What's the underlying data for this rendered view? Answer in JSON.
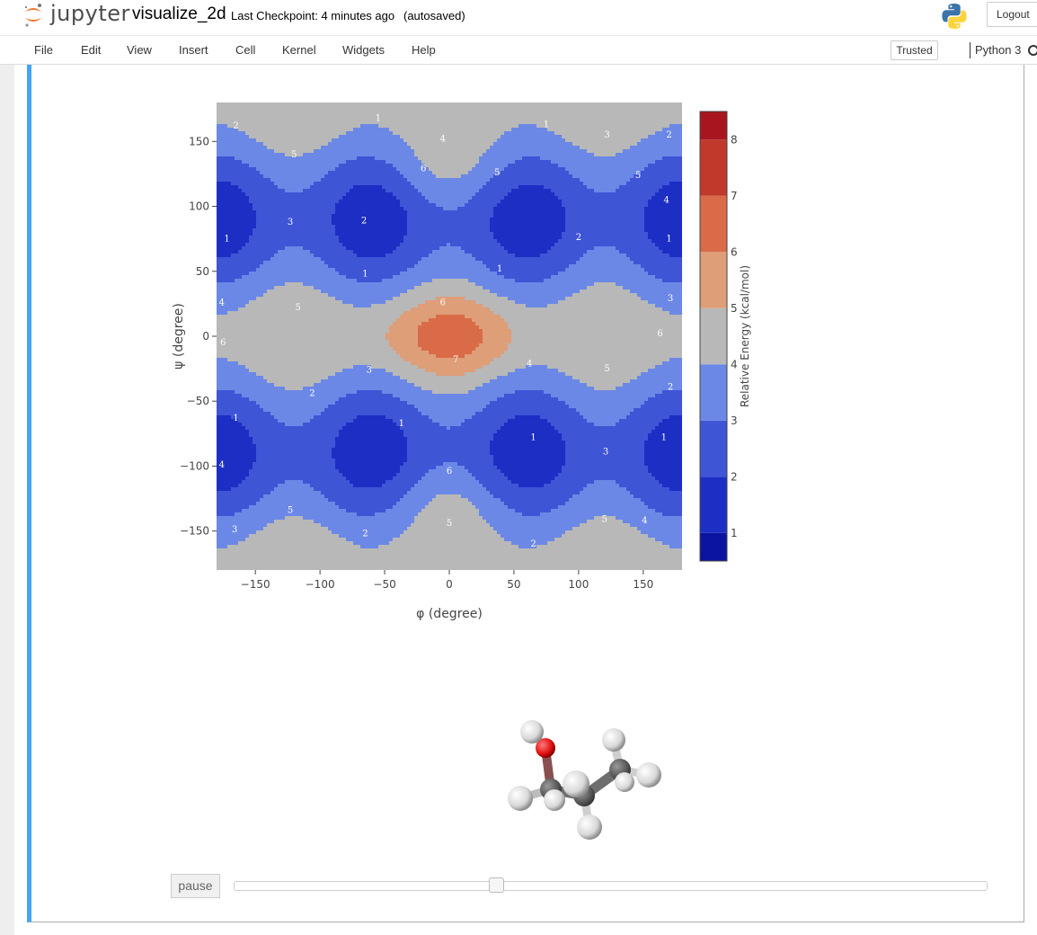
{
  "header": {
    "logo_text": "jupyter",
    "notebook_name": "visualize_2d",
    "checkpoint": "Last Checkpoint: 4 minutes ago",
    "autosave": "(autosaved)",
    "logout_label": "Logout"
  },
  "menubar": {
    "items": [
      "File",
      "Edit",
      "View",
      "Insert",
      "Cell",
      "Kernel",
      "Widgets",
      "Help"
    ],
    "trusted_label": "Trusted",
    "kernel_name": "Python 3"
  },
  "widget": {
    "pause_label": "pause",
    "slider_fraction": 0.345
  },
  "colors": {
    "cell_border_accent": "#42a5f5",
    "colorscale": [
      "#0a14a0",
      "#1c2ec4",
      "#3e55d6",
      "#6b88e6",
      "#b8b8b8",
      "#dd9e78",
      "#d96b48",
      "#c0392b",
      "#a8151f"
    ]
  },
  "chart_data": {
    "type": "contour",
    "xlabel": "φ (degree)",
    "ylabel": "ψ (degree)",
    "xlim": [
      -180,
      180
    ],
    "ylim": [
      -180,
      180
    ],
    "x_ticks": [
      -150,
      -100,
      -50,
      0,
      50,
      100,
      150
    ],
    "y_ticks": [
      150,
      100,
      50,
      0,
      -50,
      -100,
      -150
    ],
    "x_tick_labels": [
      "−150",
      "−100",
      "−50",
      "0",
      "50",
      "100",
      "150"
    ],
    "y_tick_labels": [
      "150",
      "100",
      "50",
      "0",
      "−50",
      "−100",
      "−150"
    ],
    "colorbar": {
      "title": "Relative Energy (kcal/mol)",
      "ticks": [
        1,
        2,
        3,
        4,
        5,
        6,
        7,
        8
      ],
      "range": [
        0.5,
        8.5
      ]
    },
    "contour_labels": [
      {
        "x": -165,
        "y": 162,
        "text": "2"
      },
      {
        "x": -55,
        "y": 168,
        "text": "1"
      },
      {
        "x": 75,
        "y": 163,
        "text": "1"
      },
      {
        "x": 122,
        "y": 155,
        "text": "3"
      },
      {
        "x": 170,
        "y": 155,
        "text": "2"
      },
      {
        "x": -5,
        "y": 152,
        "text": "4"
      },
      {
        "x": -120,
        "y": 140,
        "text": "5"
      },
      {
        "x": -20,
        "y": 129,
        "text": "6"
      },
      {
        "x": 37,
        "y": 126,
        "text": "5"
      },
      {
        "x": 146,
        "y": 124,
        "text": "5"
      },
      {
        "x": 168,
        "y": 105,
        "text": "4"
      },
      {
        "x": -123,
        "y": 88,
        "text": "3"
      },
      {
        "x": -66,
        "y": 89,
        "text": "2"
      },
      {
        "x": -172,
        "y": 75,
        "text": "1"
      },
      {
        "x": 100,
        "y": 76,
        "text": "2"
      },
      {
        "x": 170,
        "y": 75,
        "text": "1"
      },
      {
        "x": -65,
        "y": 48,
        "text": "1"
      },
      {
        "x": 39,
        "y": 52,
        "text": "1"
      },
      {
        "x": 171,
        "y": 29,
        "text": "3"
      },
      {
        "x": -5,
        "y": 26,
        "text": "6"
      },
      {
        "x": -176,
        "y": 26,
        "text": "4"
      },
      {
        "x": -117,
        "y": 22,
        "text": "5"
      },
      {
        "x": -175,
        "y": -5,
        "text": "6"
      },
      {
        "x": 163,
        "y": 2,
        "text": "6"
      },
      {
        "x": 5,
        "y": -18,
        "text": "7"
      },
      {
        "x": 62,
        "y": -21,
        "text": "4"
      },
      {
        "x": 122,
        "y": -25,
        "text": "5"
      },
      {
        "x": -62,
        "y": -26,
        "text": "3"
      },
      {
        "x": -106,
        "y": -44,
        "text": "2"
      },
      {
        "x": 171,
        "y": -39,
        "text": "2"
      },
      {
        "x": -165,
        "y": -63,
        "text": "1"
      },
      {
        "x": -37,
        "y": -67,
        "text": "1"
      },
      {
        "x": 65,
        "y": -78,
        "text": "1"
      },
      {
        "x": 166,
        "y": -78,
        "text": "1"
      },
      {
        "x": 121,
        "y": -89,
        "text": "3"
      },
      {
        "x": -176,
        "y": -99,
        "text": "4"
      },
      {
        "x": 0,
        "y": -104,
        "text": "6"
      },
      {
        "x": -123,
        "y": -134,
        "text": "5"
      },
      {
        "x": 0,
        "y": -144,
        "text": "5"
      },
      {
        "x": 120,
        "y": -141,
        "text": "5"
      },
      {
        "x": 151,
        "y": -142,
        "text": "4"
      },
      {
        "x": -166,
        "y": -149,
        "text": "3"
      },
      {
        "x": -65,
        "y": -152,
        "text": "2"
      },
      {
        "x": 65,
        "y": -160,
        "text": "2"
      }
    ]
  }
}
